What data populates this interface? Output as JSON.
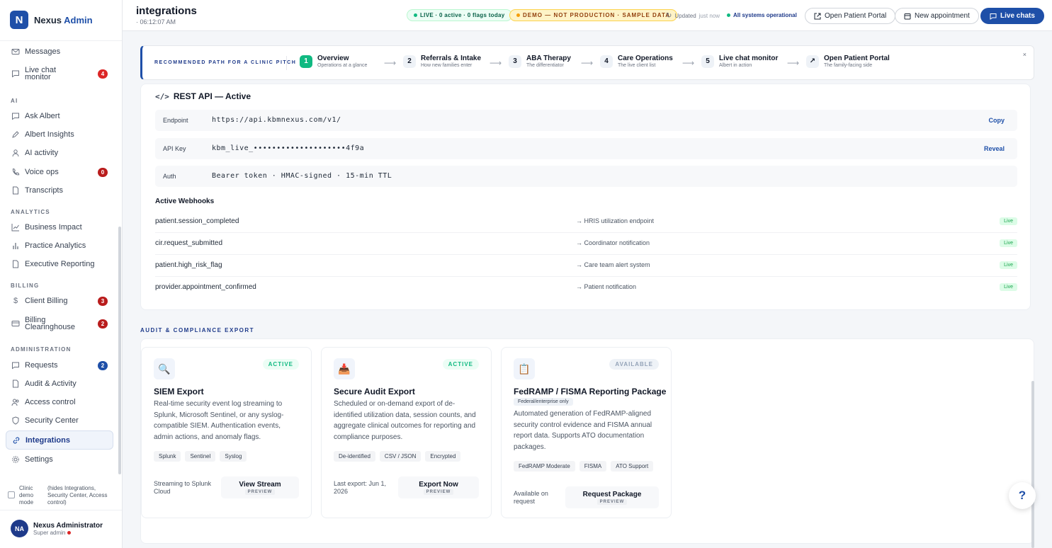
{
  "brand": {
    "name": "Nexus",
    "accent": "Admin",
    "logo": "N"
  },
  "sidebar": {
    "top_items": [
      {
        "label": "Messages",
        "icon": "mail-icon"
      },
      {
        "label": "Live chat monitor",
        "icon": "chat-icon",
        "badge": "4"
      }
    ],
    "sections": {
      "ai": "AI",
      "analytics": "ANALYTICS",
      "billing": "BILLING",
      "administration": "ADMINISTRATION"
    },
    "ai_items": [
      {
        "label": "Ask Albert",
        "icon": "chat-icon"
      },
      {
        "label": "Albert Insights",
        "icon": "pen-icon"
      },
      {
        "label": "AI activity",
        "icon": "person-icon"
      },
      {
        "label": "Voice ops",
        "icon": "phone-icon",
        "badge": "0"
      },
      {
        "label": "Transcripts",
        "icon": "doc-icon"
      }
    ],
    "analytics_items": [
      {
        "label": "Business Impact",
        "icon": "line-chart-icon"
      },
      {
        "label": "Practice Analytics",
        "icon": "bar-chart-icon"
      },
      {
        "label": "Executive Reporting",
        "icon": "doc-icon"
      }
    ],
    "billing_items": [
      {
        "label": "Client Billing",
        "icon": "dollar-icon",
        "badge": "3"
      },
      {
        "label": "Billing Clearinghouse",
        "icon": "card-icon",
        "badge": "2"
      }
    ],
    "admin_items": [
      {
        "label": "Requests",
        "icon": "chat-icon",
        "badge": "2"
      },
      {
        "label": "Audit & Activity",
        "icon": "doc-icon"
      },
      {
        "label": "Access control",
        "icon": "users-icon"
      },
      {
        "label": "Security Center",
        "icon": "shield-icon"
      },
      {
        "label": "Integrations",
        "icon": "link-icon"
      },
      {
        "label": "Settings",
        "icon": "gear-icon"
      }
    ],
    "demo_mode": {
      "label": "Clinic demo mode",
      "note": "(hides Integrations, Security Center, Access control)"
    },
    "user": {
      "initials": "NA",
      "name": "Nexus Administrator",
      "role": "Super admin"
    }
  },
  "header": {
    "title": "integrations",
    "time": "· 06:12:07 AM",
    "live_pill": "LIVE · 0 active · 0 flags today",
    "demo_pill": "DEMO — NOT PRODUCTION · SAMPLE DATA",
    "updated": "Updated",
    "updated_when": "just now",
    "systems": "All systems operational",
    "btn_portal": "Open Patient Portal",
    "btn_appt": "New appointment",
    "btn_chats": "Live chats"
  },
  "pitch": {
    "label": "RECOMMENDED PATH FOR A CLINIC PITCH",
    "steps": [
      {
        "n": "1",
        "title": "Overview",
        "sub": "Operations at a glance"
      },
      {
        "n": "2",
        "title": "Referrals & Intake",
        "sub": "How new families enter"
      },
      {
        "n": "3",
        "title": "ABA Therapy",
        "sub": "The differentiator"
      },
      {
        "n": "4",
        "title": "Care Operations",
        "sub": "The live client list"
      },
      {
        "n": "5",
        "title": "Live chat monitor",
        "sub": "Albert in action"
      },
      {
        "n": "↗",
        "title": "Open Patient Portal",
        "sub": "The family-facing side"
      }
    ],
    "arrow": "⟶",
    "close": "×"
  },
  "api": {
    "title": "REST API — Active",
    "rows": [
      {
        "key": "Endpoint",
        "value": "https://api.kbmnexus.com/v1/",
        "action": "Copy"
      },
      {
        "key": "API Key",
        "value": "kbm_live_••••••••••••••••••••4f9a",
        "action": "Reveal"
      },
      {
        "key": "Auth",
        "value": "Bearer token · HMAC-signed · 15-min TTL",
        "action": ""
      }
    ],
    "webhooks_title": "Active Webhooks",
    "webhooks": [
      {
        "event": "patient.session_completed",
        "dest": "→ HRIS utilization endpoint",
        "status": "Live"
      },
      {
        "event": "cir.request_submitted",
        "dest": "→ Coordinator notification",
        "status": "Live"
      },
      {
        "event": "patient.high_risk_flag",
        "dest": "→ Care team alert system",
        "status": "Live"
      },
      {
        "event": "provider.appointment_confirmed",
        "dest": "→ Patient notification",
        "status": "Live"
      }
    ]
  },
  "audit": {
    "heading": "AUDIT & COMPLIANCE EXPORT",
    "cards": [
      {
        "icon": "🔍",
        "icon_name": "magnifier-icon",
        "status": "ACTIVE",
        "title": "SIEM Export",
        "sub": "",
        "desc": "Real-time security event log streaming to Splunk, Microsoft Sentinel, or any syslog-compatible SIEM. Authentication events, admin actions, and anomaly flags.",
        "tags": [
          "Splunk",
          "Sentinel",
          "Syslog"
        ],
        "foot": "Streaming to Splunk Cloud",
        "button": "View Stream",
        "preview": "PREVIEW"
      },
      {
        "icon": "📥",
        "icon_name": "inbox-tray-icon",
        "status": "ACTIVE",
        "title": "Secure Audit Export",
        "sub": "",
        "desc": "Scheduled or on-demand export of de-identified utilization data, session counts, and aggregate clinical outcomes for reporting and compliance purposes.",
        "tags": [
          "De-identified",
          "CSV / JSON",
          "Encrypted"
        ],
        "foot": "Last export: Jun 1, 2026",
        "button": "Export Now",
        "preview": "PREVIEW"
      },
      {
        "icon": "📋",
        "icon_name": "clipboard-icon",
        "status": "AVAILABLE",
        "title": "FedRAMP / FISMA Reporting Package",
        "sub": "Federal/enterprise only",
        "desc": "Automated generation of FedRAMP-aligned security control evidence and FISMA annual report data. Supports ATO documentation packages.",
        "tags": [
          "FedRAMP Moderate",
          "FISMA",
          "ATO Support"
        ],
        "foot": "Available on request",
        "button": "Request Package",
        "preview": "PREVIEW"
      }
    ]
  },
  "help": "?"
}
